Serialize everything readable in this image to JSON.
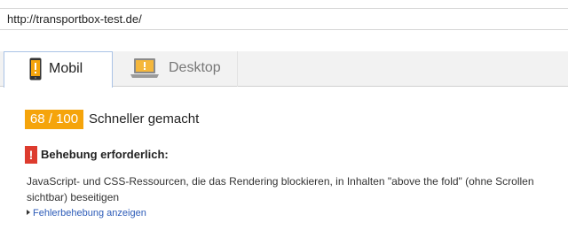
{
  "url": "http://transportbox-test.de/",
  "tabs": [
    {
      "label": "Mobil",
      "icon": "phone-icon",
      "active": true
    },
    {
      "label": "Desktop",
      "icon": "laptop-icon",
      "active": false
    }
  ],
  "score": {
    "value": "68 / 100",
    "label": "Schneller gemacht",
    "color": "#f5a40b"
  },
  "issue": {
    "badge": "!",
    "badge_color": "#dd3b2e",
    "title": "Behebung erforderlich:",
    "description": "JavaScript- und CSS-Ressourcen, die das Rendering blockieren, in Inhalten \"above the fold\" (ohne Scrollen sichtbar) beseitigen",
    "link": "Fehlerbehebung anzeigen"
  }
}
